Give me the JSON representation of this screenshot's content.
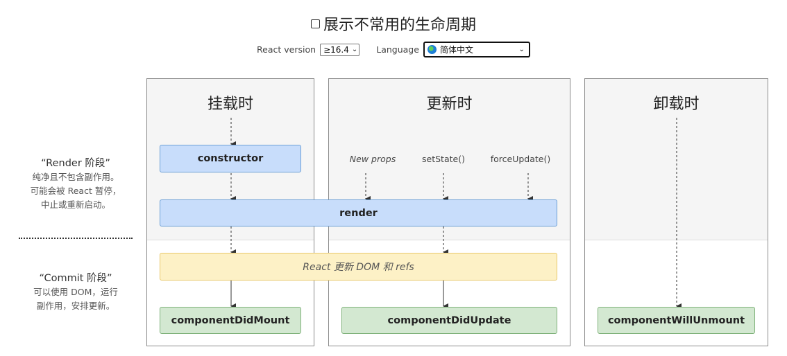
{
  "header": {
    "title": "展示不常用的生命周期",
    "react_version_label": "React version",
    "react_version_value": "≥16.4",
    "language_label": "Language",
    "language_value": "简体中文"
  },
  "phases": {
    "mount": "挂载时",
    "update": "更新时",
    "unmount": "卸载时"
  },
  "stages": {
    "render_title": "“Render 阶段”",
    "render_desc": [
      "纯净且不包含副作用。",
      "可能会被 React 暂停，",
      "中止或重新启动。"
    ],
    "commit_title": "“Commit 阶段”",
    "commit_desc": [
      "可以使用 DOM，运行",
      "副作用，安排更新。"
    ]
  },
  "triggers": {
    "new_props": "New props",
    "set_state": "setState()",
    "force_update": "forceUpdate()"
  },
  "nodes": {
    "constructor": "constructor",
    "render": "render",
    "react_updates": "React 更新 DOM 和 refs",
    "did_mount": "componentDidMount",
    "did_update": "componentDidUpdate",
    "will_unmount": "componentWillUnmount"
  },
  "colors": {
    "render_node": "#c8ddfb",
    "commit_node": "#fdf1c6",
    "lifecycle_node": "#d3e8d1"
  }
}
